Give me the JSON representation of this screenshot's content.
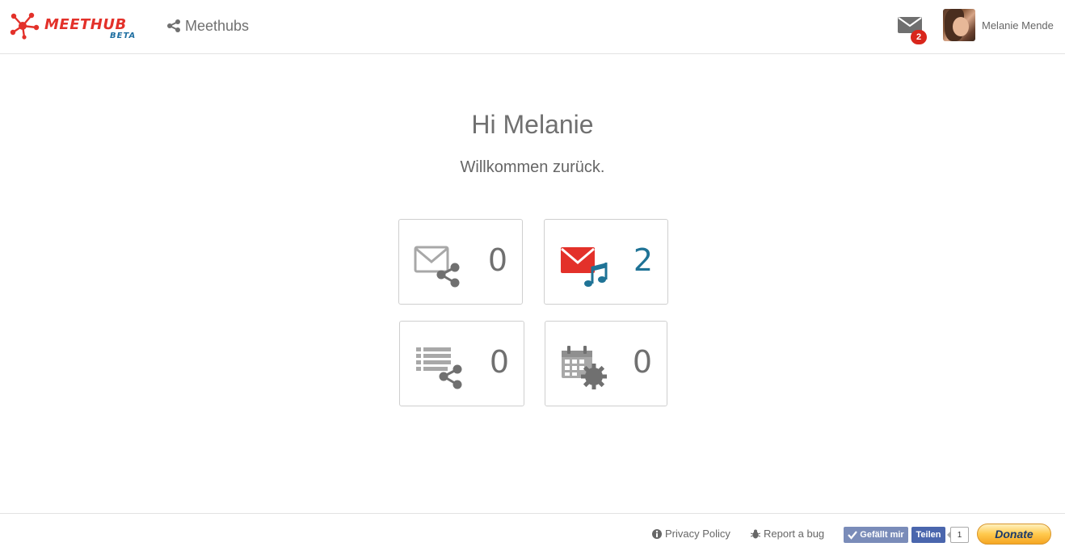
{
  "header": {
    "logo_text": "MEETHUB",
    "logo_badge": "BETA",
    "nav_label": "Meethubs",
    "mail_badge_count": "2",
    "user_name": "Melanie Mende"
  },
  "main": {
    "greeting": "Hi Melanie",
    "welcome": "Willkommen zurück.",
    "tiles": [
      {
        "icon": "mail-share-icon",
        "count": "0"
      },
      {
        "icon": "mail-music-icon",
        "count": "2"
      },
      {
        "icon": "list-share-icon",
        "count": "0"
      },
      {
        "icon": "calendar-gear-icon",
        "count": "0"
      }
    ]
  },
  "footer": {
    "privacy_label": "Privacy Policy",
    "bug_label": "Report a bug",
    "like_label": "Gefällt mir",
    "share_label": "Teilen",
    "share_count": "1",
    "donate_label": "Donate"
  },
  "colors": {
    "brand_red": "#e3312a",
    "brand_blue": "#1f7396",
    "badge_red": "#d9261c",
    "icon_gray": "#8a8a8a"
  }
}
